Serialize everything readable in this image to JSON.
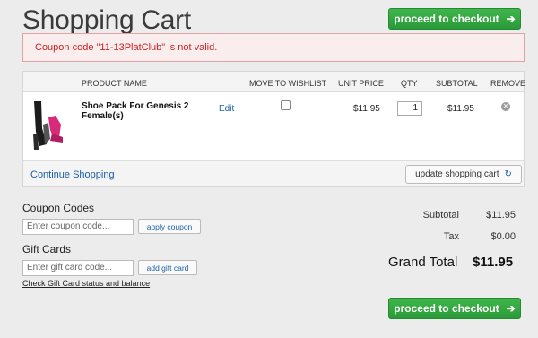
{
  "page": {
    "title": "Shopping Cart",
    "checkout_label": "proceed to checkout",
    "checkout_arrow": "➔"
  },
  "error": {
    "message": "Coupon code \"11-13PlatClub\" is not valid."
  },
  "cart": {
    "headers": {
      "product": "PRODUCT NAME",
      "wishlist": "MOVE TO WISHLIST",
      "unit_price": "UNIT PRICE",
      "qty": "QTY",
      "subtotal": "SUBTOTAL",
      "remove": "REMOVE"
    },
    "items": [
      {
        "name": "Shoe Pack For Genesis 2 Female(s)",
        "edit": "Edit",
        "wishlist_checked": false,
        "unit_price": "$11.95",
        "qty": "1",
        "subtotal": "$11.95"
      }
    ],
    "continue_label": "Continue Shopping",
    "update_label": "update shopping cart",
    "update_icon": "↻"
  },
  "coupon": {
    "label": "Coupon Codes",
    "placeholder": "Enter coupon code...",
    "button": "apply coupon"
  },
  "gift": {
    "label": "Gift Cards",
    "placeholder": "Enter gift card code...",
    "button": "add gift card",
    "status_link": "Check Gift Card status and balance"
  },
  "totals": {
    "subtotal_label": "Subtotal",
    "subtotal_value": "$11.95",
    "tax_label": "Tax",
    "tax_value": "$0.00",
    "grand_label": "Grand Total",
    "grand_value": "$11.95"
  },
  "colors": {
    "accent_green": "#2e9e3c",
    "error_red": "#cc2222",
    "link_blue": "#1a5ea8"
  }
}
